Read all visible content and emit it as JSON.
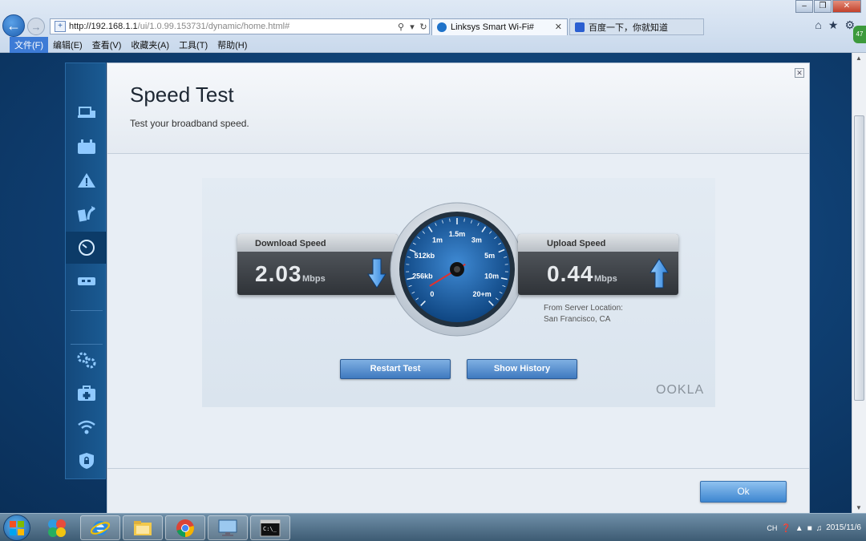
{
  "browser": {
    "url_host": "http://192.168.1.1",
    "url_path": "/ui/1.0.99.153731/dynamic/home.html#",
    "tabs": [
      {
        "title": "Linksys Smart Wi-Fi#",
        "active": true
      },
      {
        "title": "百度一下，你就知道",
        "active": false
      }
    ],
    "menu": [
      "文件(F)",
      "编辑(E)",
      "查看(V)",
      "收藏夹(A)",
      "工具(T)",
      "帮助(H)"
    ],
    "accent_color": "#3d7bd6"
  },
  "sidebar": {
    "items": [
      {
        "icon": "devices-icon"
      },
      {
        "icon": "parental-icon"
      },
      {
        "icon": "alert-icon"
      },
      {
        "icon": "media-icon"
      },
      {
        "icon": "speedtest-icon",
        "selected": true
      },
      {
        "icon": "usb-icon"
      },
      {
        "icon": "settings-icon"
      },
      {
        "icon": "troubleshoot-icon"
      },
      {
        "icon": "wifi-icon"
      },
      {
        "icon": "security-icon"
      }
    ]
  },
  "speed_test": {
    "title": "Speed Test",
    "subtitle": "Test your broadband speed.",
    "download": {
      "label": "Download Speed",
      "value": "2.03",
      "unit": "Mbps"
    },
    "upload": {
      "label": "Upload Speed",
      "value": "0.44",
      "unit": "Mbps"
    },
    "gauge": {
      "labels": [
        "0",
        "256kb",
        "512kb",
        "1m",
        "1.5m",
        "3m",
        "5m",
        "10m",
        "20+m"
      ],
      "needle_index": 0.4
    },
    "server_location_label": "From Server Location:",
    "server_location": "San Francisco, CA",
    "restart_label": "Restart Test",
    "history_label": "Show History",
    "brand": "OOKLA",
    "ok_label": "Ok"
  },
  "system": {
    "tray_lang": "CH",
    "date": "2015/11/6",
    "notification_badge": "47"
  }
}
